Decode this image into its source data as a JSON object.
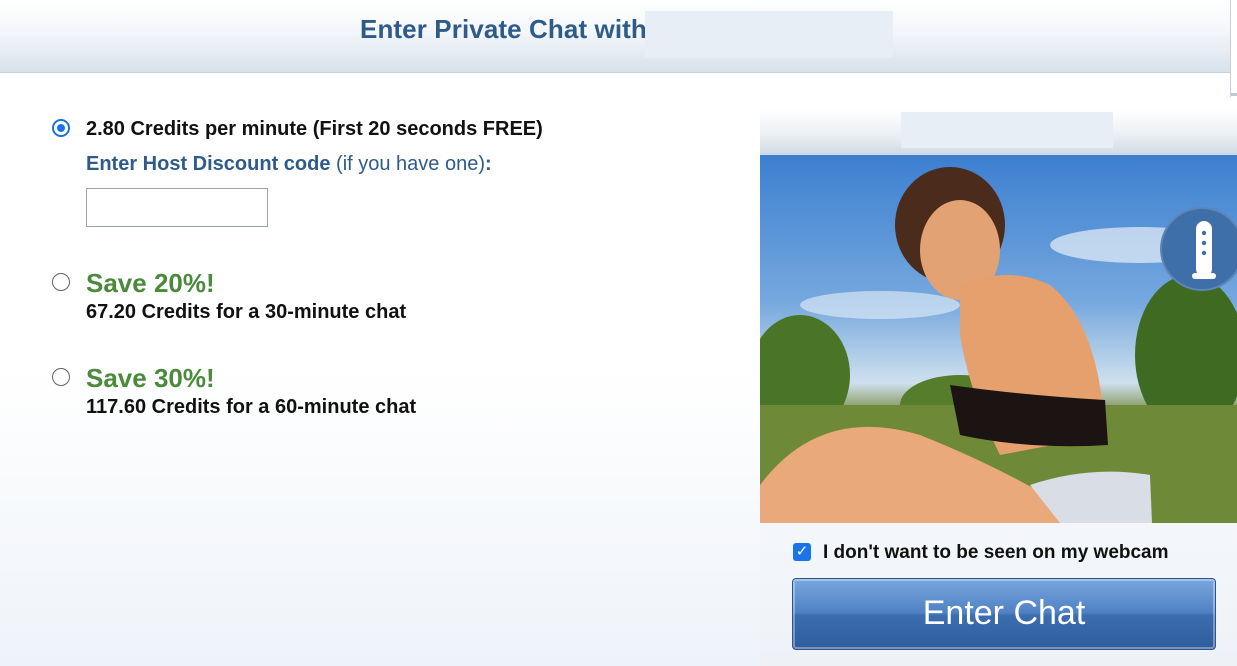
{
  "header": {
    "title": "Enter Private Chat with",
    "host_name_redacted": true
  },
  "options": [
    {
      "id": "per_minute",
      "selected": true,
      "label": "2.80 Credits per minute (First 20 seconds FREE)",
      "discount_prompt_bold": "Enter Host Discount code",
      "discount_prompt_rest": " (if you have one)",
      "discount_colon": ":",
      "discount_value": ""
    },
    {
      "id": "save20",
      "selected": false,
      "title": "Save 20%!",
      "subtitle": "67.20 Credits for a 30-minute chat"
    },
    {
      "id": "save30",
      "selected": false,
      "title": "Save 30%!",
      "subtitle": "117.60 Credits for a 60-minute chat"
    }
  ],
  "panel": {
    "host_name_redacted": true,
    "toy_badge_icon": "vibrator-toy-icon",
    "webcam_checkbox_checked": true,
    "webcam_label": "I don't want to be seen on my webcam",
    "enter_button_label": "Enter Chat"
  },
  "colors": {
    "title_blue": "#2e5b8a",
    "save_green": "#4a8a3a",
    "button_blue": "#3b6db0",
    "radio_blue": "#1a73e8"
  }
}
